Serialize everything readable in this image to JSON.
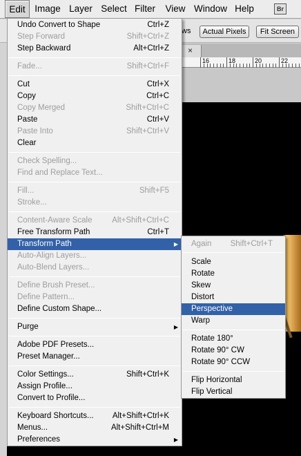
{
  "menubar": {
    "items": [
      "Edit",
      "Image",
      "Layer",
      "Select",
      "Filter",
      "View",
      "Window",
      "Help"
    ],
    "bridge_button": "Br"
  },
  "options_bar": {
    "fragment": "ws",
    "actual_pixels": "Actual Pixels",
    "fit_screen": "Fit Screen"
  },
  "document": {
    "tab_close": "×",
    "ruler_numbers": [
      "16",
      "18",
      "20",
      "22"
    ]
  },
  "edit_menu": {
    "items": [
      {
        "label": "Undo Convert to Shape",
        "shortcut": "Ctrl+Z",
        "disabled": false
      },
      {
        "label": "Step Forward",
        "shortcut": "Shift+Ctrl+Z",
        "disabled": true
      },
      {
        "label": "Step Backward",
        "shortcut": "Alt+Ctrl+Z",
        "disabled": false
      },
      {
        "label": "Fade...",
        "shortcut": "Shift+Ctrl+F",
        "disabled": true
      },
      {
        "label": "Cut",
        "shortcut": "Ctrl+X",
        "disabled": false
      },
      {
        "label": "Copy",
        "shortcut": "Ctrl+C",
        "disabled": false
      },
      {
        "label": "Copy Merged",
        "shortcut": "Shift+Ctrl+C",
        "disabled": true
      },
      {
        "label": "Paste",
        "shortcut": "Ctrl+V",
        "disabled": false
      },
      {
        "label": "Paste Into",
        "shortcut": "Shift+Ctrl+V",
        "disabled": true
      },
      {
        "label": "Clear",
        "shortcut": "",
        "disabled": false
      },
      {
        "label": "Check Spelling...",
        "shortcut": "",
        "disabled": true
      },
      {
        "label": "Find and Replace Text...",
        "shortcut": "",
        "disabled": true
      },
      {
        "label": "Fill...",
        "shortcut": "Shift+F5",
        "disabled": true
      },
      {
        "label": "Stroke...",
        "shortcut": "",
        "disabled": true
      },
      {
        "label": "Content-Aware Scale",
        "shortcut": "Alt+Shift+Ctrl+C",
        "disabled": true
      },
      {
        "label": "Free Transform Path",
        "shortcut": "Ctrl+T",
        "disabled": false
      },
      {
        "label": "Transform Path",
        "shortcut": "",
        "disabled": false,
        "highlighted": true,
        "submenu": true
      },
      {
        "label": "Auto-Align Layers...",
        "shortcut": "",
        "disabled": true
      },
      {
        "label": "Auto-Blend Layers...",
        "shortcut": "",
        "disabled": true
      },
      {
        "label": "Define Brush Preset...",
        "shortcut": "",
        "disabled": true
      },
      {
        "label": "Define Pattern...",
        "shortcut": "",
        "disabled": true
      },
      {
        "label": "Define Custom Shape...",
        "shortcut": "",
        "disabled": false
      },
      {
        "label": "Purge",
        "shortcut": "",
        "disabled": false,
        "submenu": true
      },
      {
        "label": "Adobe PDF Presets...",
        "shortcut": "",
        "disabled": false
      },
      {
        "label": "Preset Manager...",
        "shortcut": "",
        "disabled": false
      },
      {
        "label": "Color Settings...",
        "shortcut": "Shift+Ctrl+K",
        "disabled": false
      },
      {
        "label": "Assign Profile...",
        "shortcut": "",
        "disabled": false
      },
      {
        "label": "Convert to Profile...",
        "shortcut": "",
        "disabled": false
      },
      {
        "label": "Keyboard Shortcuts...",
        "shortcut": "Alt+Shift+Ctrl+K",
        "disabled": false
      },
      {
        "label": "Menus...",
        "shortcut": "Alt+Shift+Ctrl+M",
        "disabled": false
      },
      {
        "label": "Preferences",
        "shortcut": "",
        "disabled": false,
        "submenu": true
      }
    ]
  },
  "transform_submenu": {
    "items": [
      {
        "label": "Again",
        "shortcut": "Shift+Ctrl+T",
        "disabled": true
      },
      {
        "label": "Scale",
        "shortcut": "",
        "disabled": false
      },
      {
        "label": "Rotate",
        "shortcut": "",
        "disabled": false
      },
      {
        "label": "Skew",
        "shortcut": "",
        "disabled": false
      },
      {
        "label": "Distort",
        "shortcut": "",
        "disabled": false
      },
      {
        "label": "Perspective",
        "shortcut": "",
        "disabled": false,
        "highlighted": true
      },
      {
        "label": "Warp",
        "shortcut": "",
        "disabled": false
      },
      {
        "label": "Rotate 180°",
        "shortcut": "",
        "disabled": false
      },
      {
        "label": "Rotate 90° CW",
        "shortcut": "",
        "disabled": false
      },
      {
        "label": "Rotate 90° CCW",
        "shortcut": "",
        "disabled": false
      },
      {
        "label": "Flip Horizontal",
        "shortcut": "",
        "disabled": false
      },
      {
        "label": "Flip Vertical",
        "shortcut": "",
        "disabled": false
      }
    ]
  },
  "colors": {
    "highlight": "#3261a8",
    "disabled_text": "#9d9d9d",
    "menu_bg": "#f0f0f0"
  }
}
